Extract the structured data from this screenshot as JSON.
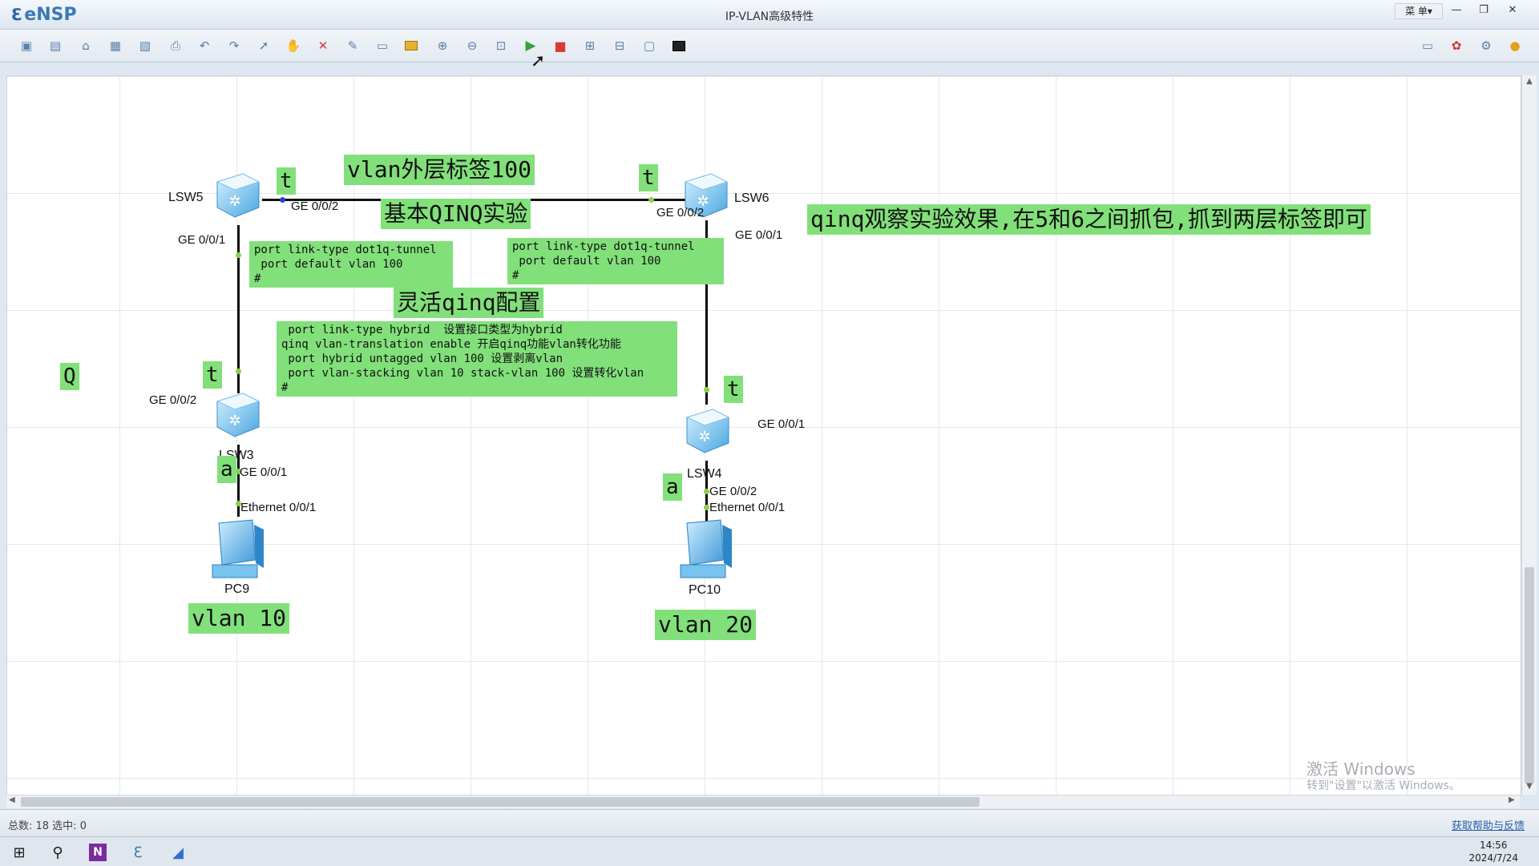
{
  "titlebar": {
    "app_name": "eNSP",
    "title": "IP-VLAN高级特性",
    "menu": "菜 单▾",
    "btn_min": "—",
    "btn_restore": "❐",
    "btn_close": "✕"
  },
  "toolbar": {
    "icons": [
      "new-topology-icon",
      "new-blank-icon",
      "open-icon",
      "save-icon",
      "save-as-icon",
      "print-icon",
      "undo-icon",
      "redo-icon",
      "select-icon",
      "pan-icon",
      "delete-icon",
      "delete-link-icon",
      "text-icon",
      "rectangle-icon",
      "zoom-in-icon",
      "zoom-out-icon",
      "fit-icon",
      "start-device-icon",
      "stop-device-icon",
      "capture-icon",
      "topology-icon",
      "window-icon",
      "screenshot-icon"
    ],
    "right_icons": [
      "chat-icon",
      "huawei-icon",
      "settings-icon",
      "help-icon"
    ]
  },
  "devices": {
    "lsw5": "LSW5",
    "lsw6": "LSW6",
    "lsw3": "LSW3",
    "lsw4": "LSW4",
    "pc9": "PC9",
    "pc10": "PC10"
  },
  "ports": {
    "lsw5_ge002": "GE 0/0/2",
    "lsw5_ge001": "GE 0/0/1",
    "lsw6_ge002": "GE 0/0/2",
    "lsw6_ge001": "GE 0/0/1",
    "lsw3_ge002": "GE 0/0/2",
    "lsw3_ge001": "GE 0/0/1",
    "lsw4_ge001": "GE 0/0/1",
    "lsw4_ge002": "GE 0/0/2",
    "pc9_eth": "Ethernet 0/0/1",
    "pc10_eth": "Ethernet 0/0/1"
  },
  "notes": {
    "outer_tag": "vlan外层标签100",
    "basic_qinq": "基本QINQ实验",
    "flexible_qinq": "灵活qinq配置",
    "observe": "qinq观察实验效果,在5和6之间抓包,抓到两层标签即可",
    "lsw5_config": "port link-type dot1q-tunnel\n port default vlan 100\n#",
    "lsw6_config": "port link-type dot1q-tunnel\n port default vlan 100\n#",
    "flex_config": " port link-type hybrid  设置接口类型为hybrid\nqinq vlan-translation enable 开启qinq功能vlan转化功能\n port hybrid untagged vlan 100 设置剥离vlan\n port vlan-stacking vlan 10 stack-vlan 100 设置转化vlan\n#",
    "vlan10": "vlan 10",
    "vlan20": "vlan 20",
    "tag_t": "t",
    "tag_a": "a",
    "tag_q": "Q"
  },
  "status": {
    "text": "总数: 18  选中: 0",
    "help": "获取帮助与反馈"
  },
  "watermark": {
    "line1": "激活 Windows",
    "line2": "转到\"设置\"以激活 Windows。"
  },
  "taskbar": {
    "time": "14:56",
    "date": "2024/7/24"
  }
}
